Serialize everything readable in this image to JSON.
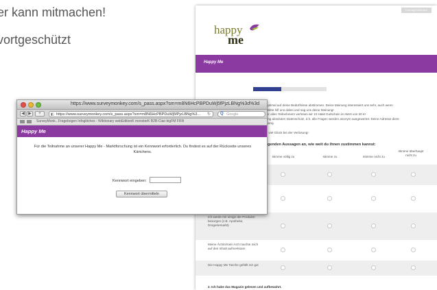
{
  "slide": {
    "line1": "er kann mitmachen!",
    "line2": "vortgeschützt"
  },
  "survey": {
    "exit_label": "Umfrage beenden",
    "logo_text_top": "happy",
    "logo_text_bottom": "me",
    "header_title": "Happy Me",
    "progress": 0.38,
    "intro_lines": [
      "r optimal auf deine Bedürfnisse abstimmen. Deine Meinung interessiert uns sehr, auch wenn",
      "n. Bitte hilf uns dabei und sag uns deine Meinung!",
      "nter allen Teilnehmern verlosen wir 10 H&M Gutschein im Wert von 20 €!",
      "gung absoluten Datenschutz, d.h. alle Fragen werden anonym ausgewertet. Deine Adresse dient",
      "losung.",
      "",
      "nd viel Glück bei der Verlosung!"
    ],
    "question1": "olgenden Aussagen an, wie weit du ihnen zustimmen kannst:",
    "columns": [
      "stimme völlig zu",
      "stimme zu",
      "stimme nicht zu",
      "stimme überhaupt nicht zu"
    ],
    "rows": [
      {
        "label": ""
      },
      {
        "label": ""
      },
      {
        "label": "Ich werde mir einige der Produkte besorgen (z.B. Apotheke, Drogeriemarkt)"
      },
      {
        "label": "Meine Ärztin/mein Arzt machte mich auf den Inhalt aufmerksam"
      },
      {
        "label": "Die Happy Me Tasche gefällt mir gut"
      }
    ],
    "question2": "2. Ich habe das Magazin gelesen und aufbewahrt."
  },
  "browser": {
    "title": "https://www.surveymonkey.com/s_pass.aspx?sm=m8N6HcPBPDuWj5fPjzLBNg%3d%3d",
    "url": "https://www.surveymonkey.com/s_pass.aspx?sm=m8N6HcPBPDuWj5fPjzLBNg%3...",
    "search_placeholder": "Google",
    "bookmarks": "SurveyMonk...Fragebogen   Infoglitches - Wiktionary   webEditionK   monsterK B2B-Ciao   bigFM   FIFA",
    "page_header": "Happy Me",
    "message": "Für die Teilnahme an unserer Happy Me - Marktforschung ist ein Kennwort erforderlich. Du findest es auf der Rückseite unseres Kärtchens.",
    "password_label": "Kennwort eingeben:",
    "password_value": "",
    "submit_label": "Kennwort übermitteln"
  },
  "colors": {
    "purple": "#8b3ba0",
    "progress_fill": "#303f90"
  }
}
